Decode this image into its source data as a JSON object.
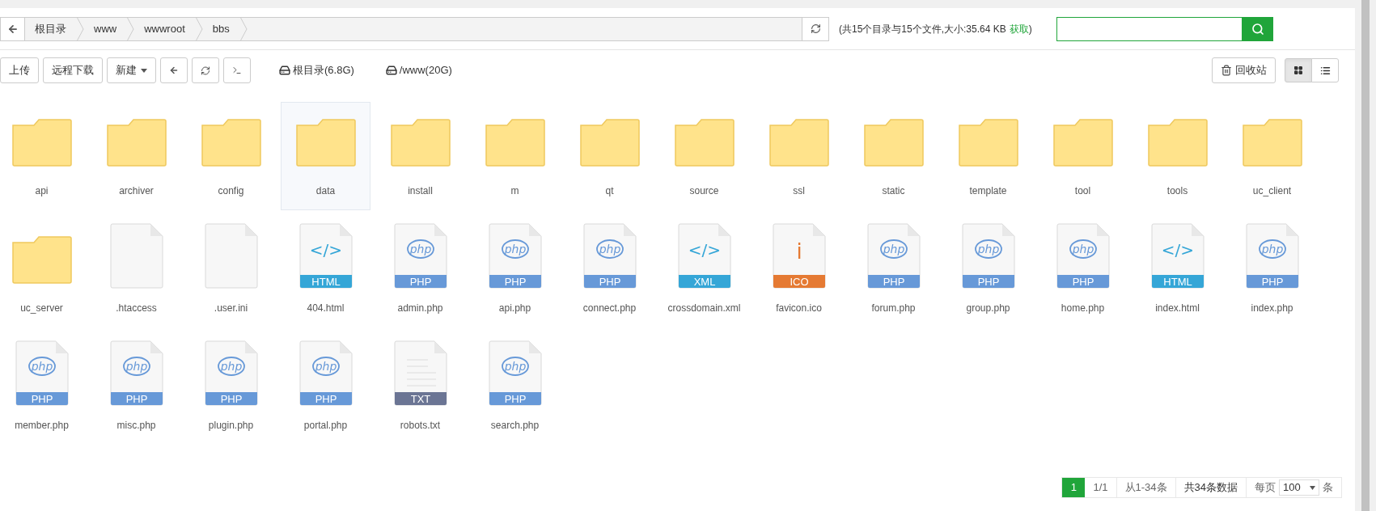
{
  "breadcrumb": {
    "items": [
      "根目录",
      "www",
      "wwwroot",
      "bbs"
    ]
  },
  "summary": {
    "text": "(共15个目录与15个文件,大小:35.64 KB",
    "link": "获取",
    "close": ")"
  },
  "toolbar": {
    "buttons": [
      "上传",
      "远程下载"
    ],
    "new_button": "新建",
    "disks": [
      "根目录(6.8G)",
      "/www(20G)"
    ],
    "recycle": "回收站"
  },
  "view_modes": [
    {
      "kind": "grid",
      "selected": true
    },
    {
      "kind": "list",
      "selected": false
    }
  ],
  "files": [
    {
      "kind": "folder",
      "name": "api",
      "selected": false
    },
    {
      "kind": "folder",
      "name": "archiver",
      "selected": false
    },
    {
      "kind": "folder",
      "name": "config",
      "selected": false
    },
    {
      "kind": "folder",
      "name": "data",
      "selected": true
    },
    {
      "kind": "folder",
      "name": "install",
      "selected": false
    },
    {
      "kind": "folder",
      "name": "m",
      "selected": false
    },
    {
      "kind": "folder",
      "name": "qt",
      "selected": false
    },
    {
      "kind": "folder",
      "name": "source",
      "selected": false
    },
    {
      "kind": "folder",
      "name": "ssl",
      "selected": false
    },
    {
      "kind": "folder",
      "name": "static",
      "selected": false
    },
    {
      "kind": "folder",
      "name": "template",
      "selected": false
    },
    {
      "kind": "folder",
      "name": "tool",
      "selected": false
    },
    {
      "kind": "folder",
      "name": "tools",
      "selected": false
    },
    {
      "kind": "folder",
      "name": "uc_client",
      "selected": false
    },
    {
      "kind": "folder",
      "name": "uc_server",
      "selected": false
    },
    {
      "kind": "blank",
      "name": ".htaccess",
      "selected": false
    },
    {
      "kind": "blank",
      "name": ".user.ini",
      "selected": false
    },
    {
      "kind": "code",
      "name": "404.html",
      "badge": "HTML",
      "glyph": "</>",
      "color": "#35a6d7",
      "selected": false
    },
    {
      "kind": "php",
      "name": "admin.php",
      "badge": "PHP",
      "glyph": "php",
      "color": "#6799d8",
      "selected": false
    },
    {
      "kind": "php",
      "name": "api.php",
      "badge": "PHP",
      "glyph": "php",
      "color": "#6799d8",
      "selected": false
    },
    {
      "kind": "php",
      "name": "connect.php",
      "badge": "PHP",
      "glyph": "php",
      "color": "#6799d8",
      "selected": false
    },
    {
      "kind": "code",
      "name": "crossdomain.xml",
      "badge": "XML",
      "glyph": "</>",
      "color": "#35a6d7",
      "selected": false
    },
    {
      "kind": "ico",
      "name": "favicon.ico",
      "badge": "ICO",
      "glyph": "i",
      "color": "#e57a33",
      "selected": false
    },
    {
      "kind": "php",
      "name": "forum.php",
      "badge": "PHP",
      "glyph": "php",
      "color": "#6799d8",
      "selected": false
    },
    {
      "kind": "php",
      "name": "group.php",
      "badge": "PHP",
      "glyph": "php",
      "color": "#6799d8",
      "selected": false
    },
    {
      "kind": "php",
      "name": "home.php",
      "badge": "PHP",
      "glyph": "php",
      "color": "#6799d8",
      "selected": false
    },
    {
      "kind": "code",
      "name": "index.html",
      "badge": "HTML",
      "glyph": "</>",
      "color": "#35a6d7",
      "selected": false
    },
    {
      "kind": "php",
      "name": "index.php",
      "badge": "PHP",
      "glyph": "php",
      "color": "#6799d8",
      "selected": false
    },
    {
      "kind": "php",
      "name": "member.php",
      "badge": "PHP",
      "glyph": "php",
      "color": "#6799d8",
      "selected": false
    },
    {
      "kind": "php",
      "name": "misc.php",
      "badge": "PHP",
      "glyph": "php",
      "color": "#6799d8",
      "selected": false
    },
    {
      "kind": "php",
      "name": "plugin.php",
      "badge": "PHP",
      "glyph": "php",
      "color": "#6799d8",
      "selected": false
    },
    {
      "kind": "php",
      "name": "portal.php",
      "badge": "PHP",
      "glyph": "php",
      "color": "#6799d8",
      "selected": false
    },
    {
      "kind": "txt",
      "name": "robots.txt",
      "badge": "TXT",
      "color": "#6b7594",
      "selected": false
    },
    {
      "kind": "php",
      "name": "search.php",
      "badge": "PHP",
      "glyph": "php",
      "color": "#6799d8",
      "selected": false
    }
  ],
  "pager": {
    "current": "1",
    "pages": "1/1",
    "range": "从1-34条",
    "total": "共34条数据",
    "per_page_label": "每页",
    "per_page": "100",
    "unit": "条"
  }
}
